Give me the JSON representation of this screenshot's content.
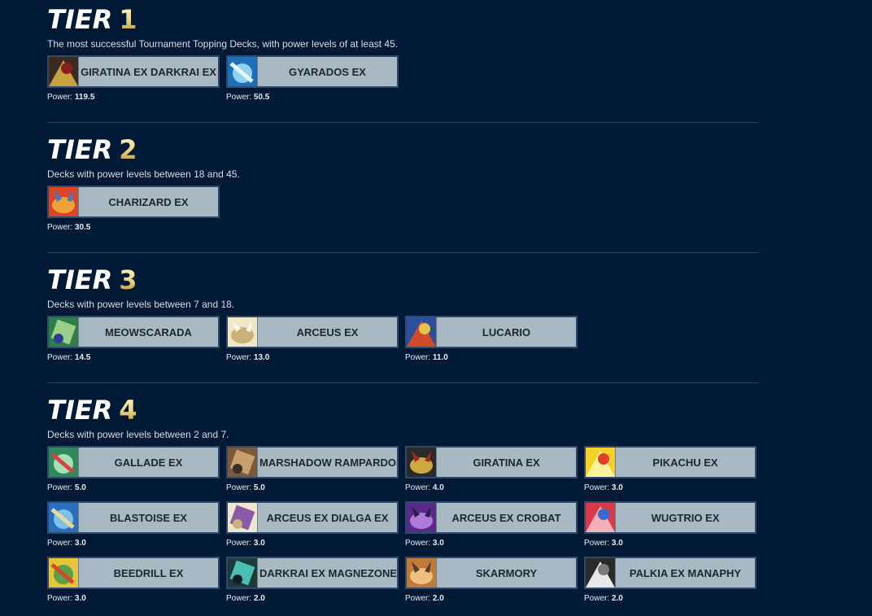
{
  "tiers": [
    {
      "word": "TIER",
      "number": "1",
      "description": "The most successful Tournament Topping Decks, with power levels of at least 45.",
      "decks": [
        {
          "name": "GIRATINA EX DARKRAI EX",
          "power_label": "Power:",
          "power": "119.5",
          "icon": "giratina-darkrai-card-icon",
          "colors": [
            "#3b2a1f",
            "#c8a23c",
            "#8a1f1f"
          ]
        },
        {
          "name": "GYARADOS EX",
          "power_label": "Power:",
          "power": "50.5",
          "icon": "gyarados-card-icon",
          "colors": [
            "#1f6fb8",
            "#8fd3f0",
            "#e8f4fb"
          ]
        }
      ]
    },
    {
      "word": "TIER",
      "number": "2",
      "description": "Decks with power levels between 18 and 45.",
      "decks": [
        {
          "name": "CHARIZARD EX",
          "power_label": "Power:",
          "power": "30.5",
          "icon": "charizard-card-icon",
          "colors": [
            "#d8452a",
            "#f0a23a",
            "#3a7ad0"
          ]
        }
      ]
    },
    {
      "word": "TIER",
      "number": "3",
      "description": "Decks with power levels between 7 and 18.",
      "decks": [
        {
          "name": "MEOWSCARADA",
          "power_label": "Power:",
          "power": "14.5",
          "icon": "meowscarada-card-icon",
          "colors": [
            "#2f7d4a",
            "#9ad08a",
            "#2a3f8f"
          ]
        },
        {
          "name": "ARCEUS EX",
          "power_label": "Power:",
          "power": "13.0",
          "icon": "arceus-card-icon",
          "colors": [
            "#efe7c6",
            "#c9b27a",
            "#f8f6ee"
          ]
        },
        {
          "name": "LUCARIO",
          "power_label": "Power:",
          "power": "11.0",
          "icon": "lucario-card-icon",
          "colors": [
            "#2b4f9a",
            "#d04a2a",
            "#e6c24a"
          ]
        }
      ]
    },
    {
      "word": "TIER",
      "number": "4",
      "description": "Decks with power levels between 2 and 7.",
      "decks": [
        {
          "name": "GALLADE EX",
          "power_label": "Power:",
          "power": "5.0",
          "icon": "gallade-card-icon",
          "colors": [
            "#2e8a5a",
            "#a8e0b6",
            "#d64545"
          ]
        },
        {
          "name": "MARSHADOW RAMPARDOS",
          "power_label": "Power:",
          "power": "5.0",
          "icon": "marshadow-rampardos-card-icon",
          "colors": [
            "#7a5a3a",
            "#c8a070",
            "#3a2f2a"
          ]
        },
        {
          "name": "GIRATINA EX",
          "power_label": "Power:",
          "power": "4.0",
          "icon": "giratina-card-icon",
          "colors": [
            "#2a2a2a",
            "#d0a840",
            "#a02a2a"
          ]
        },
        {
          "name": "PIKACHU EX",
          "power_label": "Power:",
          "power": "3.0",
          "icon": "pikachu-card-icon",
          "colors": [
            "#f4d22a",
            "#fff3a0",
            "#e0402a"
          ]
        },
        {
          "name": "BLASTOISE EX",
          "power_label": "Power:",
          "power": "3.0",
          "icon": "blastoise-card-icon",
          "colors": [
            "#2a6ec0",
            "#7fc0e8",
            "#e8d8a0"
          ]
        },
        {
          "name": "ARCEUS EX DIALGA EX",
          "power_label": "Power:",
          "power": "3.0",
          "icon": "arceus-dialga-card-icon",
          "colors": [
            "#efe7d0",
            "#8a5aa8",
            "#c9b27a"
          ]
        },
        {
          "name": "ARCEUS EX CROBAT",
          "power_label": "Power:",
          "power": "3.0",
          "icon": "arceus-crobat-card-icon",
          "colors": [
            "#5a2a8a",
            "#b07ad8",
            "#2a1f4a"
          ]
        },
        {
          "name": "WUGTRIO EX",
          "power_label": "Power:",
          "power": "3.0",
          "icon": "wugtrio-card-icon",
          "colors": [
            "#d83a4a",
            "#f3b0b8",
            "#3a6ad0"
          ]
        },
        {
          "name": "BEEDRILL EX",
          "power_label": "Power:",
          "power": "3.0",
          "icon": "beedrill-card-icon",
          "colors": [
            "#e8c43a",
            "#5aa04a",
            "#d04a2a"
          ]
        },
        {
          "name": "DARKRAI EX MAGNEZONE",
          "power_label": "Power:",
          "power": "2.0",
          "icon": "darkrai-magnezone-card-icon",
          "colors": [
            "#1f3a3a",
            "#4ac0b0",
            "#0f1f2a"
          ]
        },
        {
          "name": "SKARMORY",
          "power_label": "Power:",
          "power": "2.0",
          "icon": "skarmory-card-icon",
          "colors": [
            "#c07a3a",
            "#f0c080",
            "#5a3a2a"
          ]
        },
        {
          "name": "PALKIA EX MANAPHY",
          "power_label": "Power:",
          "power": "2.0",
          "icon": "palkia-manaphy-card-icon",
          "colors": [
            "#2a2a2a",
            "#e8e8e8",
            "#7a7a7a"
          ]
        }
      ]
    }
  ]
}
